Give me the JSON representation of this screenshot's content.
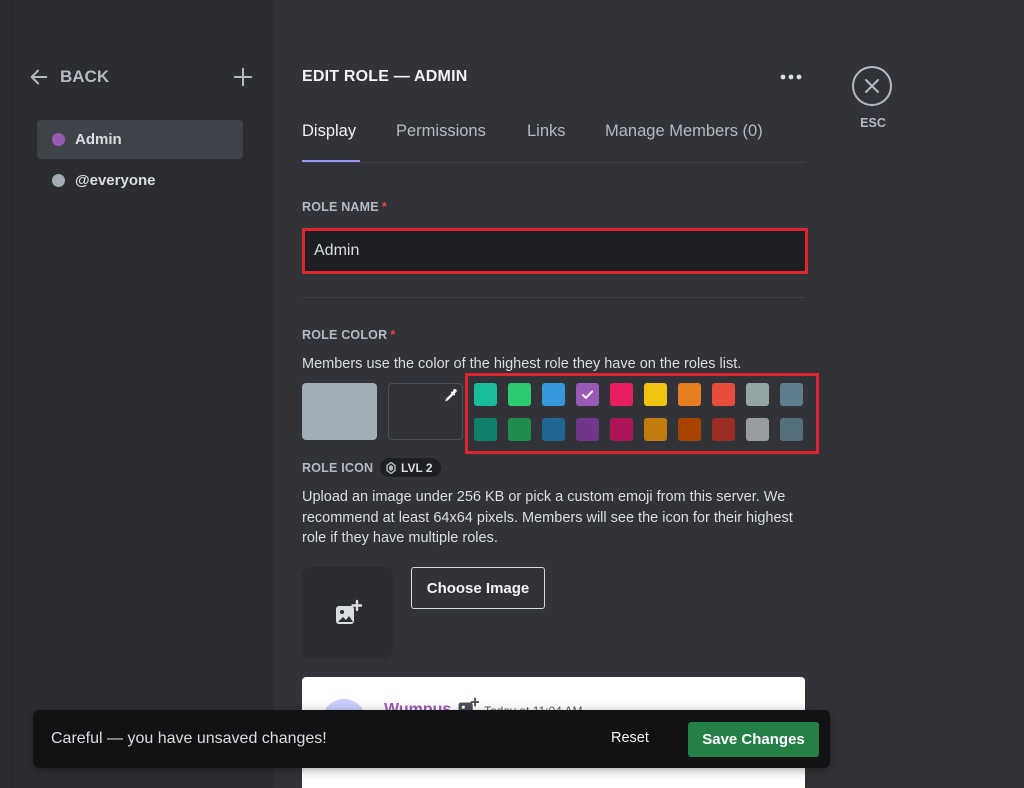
{
  "sidebar": {
    "back_label": "BACK",
    "roles": [
      {
        "label": "Admin",
        "color": "#9b59b6"
      },
      {
        "label": "@everyone",
        "color": "#a0acb6"
      }
    ]
  },
  "header": {
    "title": "EDIT ROLE — ADMIN",
    "tabs": [
      {
        "label": "Display"
      },
      {
        "label": "Permissions"
      },
      {
        "label": "Links"
      },
      {
        "label": "Manage Members (0)"
      }
    ]
  },
  "role_name": {
    "label": "ROLE NAME",
    "required_mark": "*",
    "value": "Admin"
  },
  "role_color": {
    "label": "ROLE COLOR",
    "required_mark": "*",
    "description": "Members use the color of the highest role they have on the roles list.",
    "current_color": "#a0acb6",
    "selected_swatch": "#9b59b6",
    "swatches_row1": [
      "#1abc9c",
      "#2ecc71",
      "#3498db",
      "#9b59b6",
      "#e91e63",
      "#f1c40f",
      "#e67e22",
      "#e74c3c",
      "#95a5a6",
      "#607d8b"
    ],
    "swatches_row2": [
      "#11806a",
      "#1f8b4c",
      "#206694",
      "#71368a",
      "#ad1457",
      "#c27c0e",
      "#a84300",
      "#992d22",
      "#979c9f",
      "#546e7a"
    ]
  },
  "role_icon": {
    "label": "ROLE ICON",
    "level_badge": "LVL 2",
    "description": "Upload an image under 256 KB or pick a custom emoji from this server. We recommend at least 64x64 pixels. Members will see the icon for their highest role if they have multiple roles.",
    "choose_label": "Choose Image"
  },
  "preview": {
    "username": "Wumpus",
    "timestamp": "Today at 11:04 AM"
  },
  "close": {
    "label": "ESC"
  },
  "notice": {
    "text": "Careful — you have unsaved changes!",
    "reset_label": "Reset",
    "save_label": "Save Changes"
  }
}
